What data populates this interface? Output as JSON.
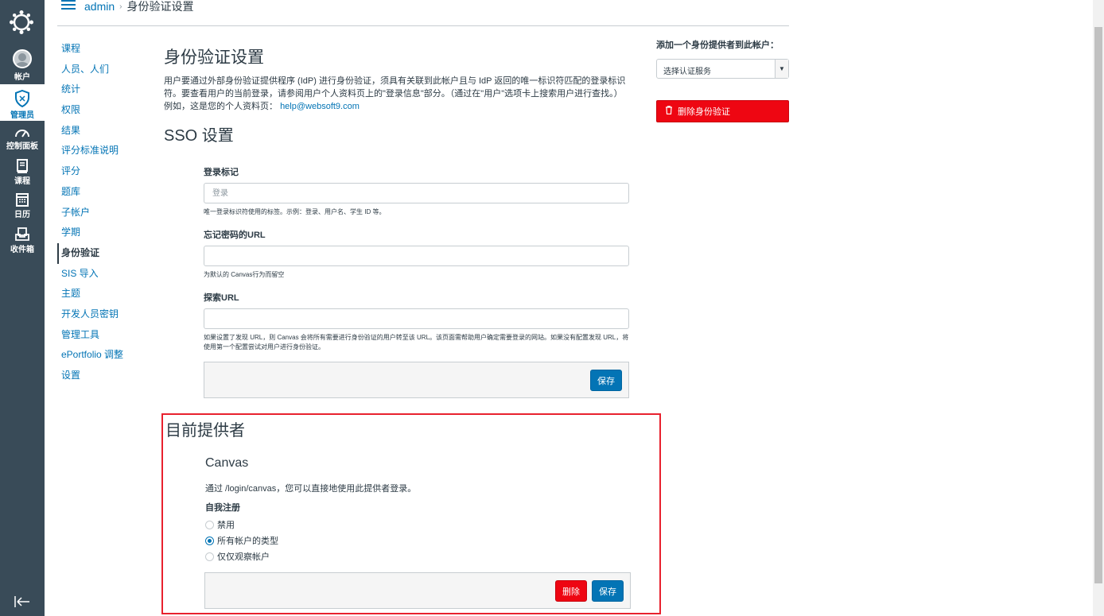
{
  "global_nav": {
    "items": [
      {
        "label": "帐户",
        "icon": "account-avatar"
      },
      {
        "label": "管理员",
        "icon": "shield-icon",
        "active": true
      },
      {
        "label": "控制面板",
        "icon": "dashboard-icon"
      },
      {
        "label": "课程",
        "icon": "courses-icon"
      },
      {
        "label": "日历",
        "icon": "calendar-icon"
      },
      {
        "label": "收件箱",
        "icon": "inbox-icon"
      }
    ],
    "collapse_icon": "collapse-nav-icon"
  },
  "breadcrumb": {
    "root": "admin",
    "current": "身份验证设置"
  },
  "subnav": {
    "items": [
      "课程",
      "人员、人们",
      "统计",
      "权限",
      "结果",
      "评分标准说明",
      "评分",
      "题库",
      "子帐户",
      "学期",
      "身份验证",
      "SIS 导入",
      "主题",
      "开发人员密钥",
      "管理工具",
      "ePortfolio 调整",
      "设置"
    ],
    "active_index": 10
  },
  "main": {
    "title": "身份验证设置",
    "intro_line1": "用户要通过外部身份验证提供程序 (IdP) 进行身份验证，须具有关联到此帐户且与 IdP 返回的唯一标识符匹配的登录标识符。要查看用户的当前登录，请参阅用户个人资料页上的\"登录信息\"部分。（通过在\"用户\"选项卡上搜索用户进行查找。）",
    "example_prefix": "例如，这是您的个人资料页：",
    "example_link": "help@websoft9.com",
    "sso_title": "SSO 设置",
    "login_label": {
      "label": "登录标记",
      "placeholder": "登录",
      "help": "唯一登录标识符使用的标签。示例：登录、用户名、学生 ID 等。"
    },
    "forgot_url": {
      "label": "忘记密码的URL",
      "value": "",
      "help": "为默认的 Canvas行为而留空"
    },
    "discovery_url": {
      "label": "探索URL",
      "value": "",
      "help": "如果设置了发现 URL，则 Canvas 会将所有需要进行身份验证的用户转至该 URL。该页面需帮助用户确定需要登录的网站。如果没有配置发现 URL，将使用第一个配置尝试对用户进行身份验证。"
    },
    "save_label": "保存"
  },
  "providers": {
    "title": "目前提供者",
    "provider_name": "Canvas",
    "description": "通过 /login/canvas，您可以直接地使用此提供者登录。",
    "self_registration_label": "自我注册",
    "options": [
      {
        "label": "禁用",
        "checked": false
      },
      {
        "label": "所有帐户的类型",
        "checked": true
      },
      {
        "label": "仅仅观察帐户",
        "checked": false
      }
    ],
    "delete_label": "删除",
    "save_label": "保存"
  },
  "sidebar": {
    "add_label": "添加一个身份提供者到此帐户：",
    "select_value": "选择认证服务",
    "delete_auth_label": "删除身份验证"
  },
  "colors": {
    "nav_bg": "#394b58",
    "link": "#0374b5",
    "danger": "#ee0612",
    "highlight_border": "#e8212e"
  }
}
